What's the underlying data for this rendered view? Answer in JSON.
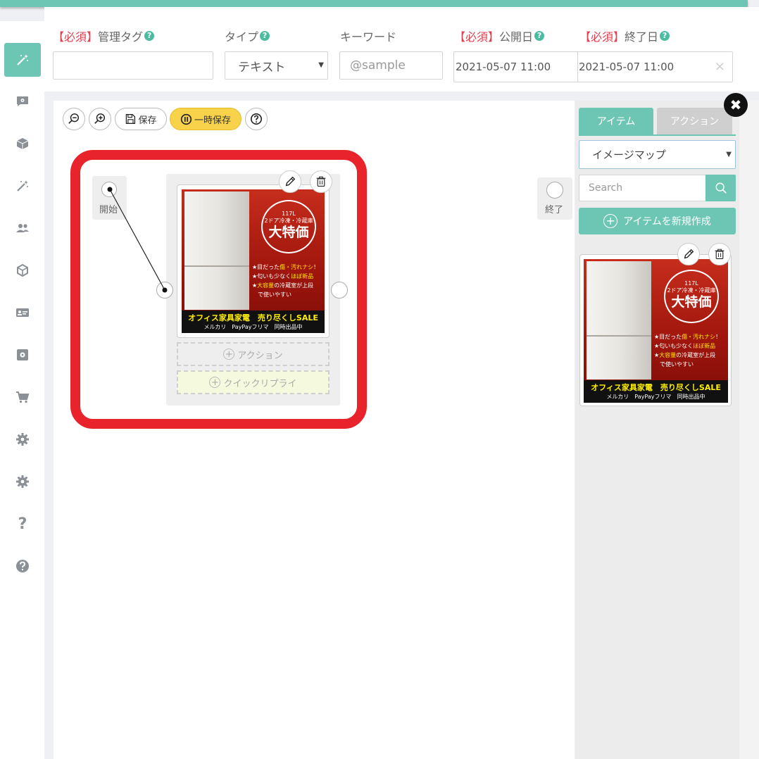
{
  "header": {
    "required_mark": "【必須】",
    "tag_label": "管理タグ",
    "type_label": "タイプ",
    "type_value": "テキスト",
    "keyword_label": "キーワード",
    "keyword_placeholder": "@sample",
    "publish_label": "公開日",
    "publish_value": "2021-05-07 11:00",
    "end_label": "終了日",
    "end_value": "2021-05-07 11:00",
    "clear_glyph": "×",
    "help_glyph": "?"
  },
  "toolbar": {
    "save_label": "保存",
    "temp_save_label": "一時保存"
  },
  "flow": {
    "start_label": "開始",
    "end_label": "終了",
    "action_label": "アクション",
    "quick_reply_label": "クイックリプライ",
    "plus_glyph": "+"
  },
  "ad": {
    "bubble_line1": "117L",
    "bubble_line2": "2ドア冷凍・冷蔵庫",
    "bubble_main": "大特価",
    "bullet1_pre": "★目だった",
    "bullet1_hl": "傷・汚れナシ",
    "bullet1_post": "！",
    "bullet2_pre": "★匂いも少なく",
    "bullet2_hl": "ほぼ新品",
    "bullet3_pre": "★",
    "bullet3_hl": "大容量",
    "bullet3_post": "の冷蔵室が上段",
    "bullet3_line2": "で使いやすい",
    "footer_main": "オフィス家具家電　売り尽くしSALE",
    "footer_sub": "メルカリ　PayPayフリマ　同時出品中"
  },
  "panel": {
    "tab_items": "アイテム",
    "tab_actions": "アクション",
    "select_value": "イメージマップ",
    "search_placeholder": "Search",
    "new_item_label": "アイテムを新規作成",
    "close_glyph": "✖"
  },
  "sidebar": {
    "items": [
      {
        "icon": "magic-wand-icon",
        "active": true
      },
      {
        "icon": "chat-gear-icon",
        "active": false
      },
      {
        "icon": "box-icon",
        "active": false
      },
      {
        "icon": "magic-wand-icon",
        "active": false
      },
      {
        "icon": "users-icon",
        "active": false
      },
      {
        "icon": "cube-icon",
        "active": false
      },
      {
        "icon": "id-card-icon",
        "active": false
      },
      {
        "icon": "gear-box-icon",
        "active": false
      },
      {
        "icon": "cart-icon",
        "active": false
      },
      {
        "icon": "gear-icon",
        "active": false
      },
      {
        "icon": "gear-icon",
        "active": false
      },
      {
        "icon": "question-icon",
        "active": false
      },
      {
        "icon": "help-circle-icon",
        "active": false
      }
    ],
    "question_glyph": "?"
  },
  "colors": {
    "accent": "#6dc6b4",
    "required": "#e04050",
    "highlight": "#e8232b",
    "temp_save": "#f7d24a",
    "icon_gray": "#8a9095"
  }
}
